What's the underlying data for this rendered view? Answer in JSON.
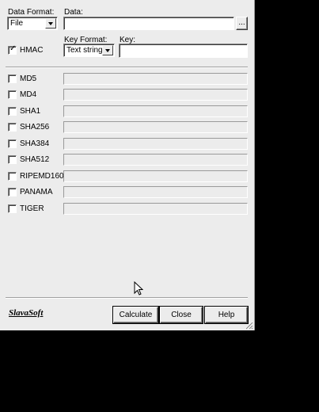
{
  "form": {
    "data_format_label": "Data Format:",
    "data_format_value": "File",
    "data_label": "Data:",
    "data_value": "",
    "browse_label": "...",
    "hmac_label": "HMAC",
    "hmac_checked": true,
    "key_format_label": "Key Format:",
    "key_format_value": "Text string",
    "key_label": "Key:",
    "key_value": ""
  },
  "algorithms": [
    {
      "label": "MD5",
      "checked": false,
      "value": ""
    },
    {
      "label": "MD4",
      "checked": false,
      "value": ""
    },
    {
      "label": "SHA1",
      "checked": false,
      "value": ""
    },
    {
      "label": "SHA256",
      "checked": false,
      "value": ""
    },
    {
      "label": "SHA384",
      "checked": false,
      "value": ""
    },
    {
      "label": "SHA512",
      "checked": false,
      "value": ""
    },
    {
      "label": "RIPEMD160",
      "checked": false,
      "value": ""
    },
    {
      "label": "PANAMA",
      "checked": false,
      "value": ""
    },
    {
      "label": "TIGER",
      "checked": false,
      "value": ""
    }
  ],
  "footer": {
    "brand": "SlavaSoft",
    "calculate_label": "Calculate",
    "close_label": "Close",
    "help_label": "Help"
  }
}
